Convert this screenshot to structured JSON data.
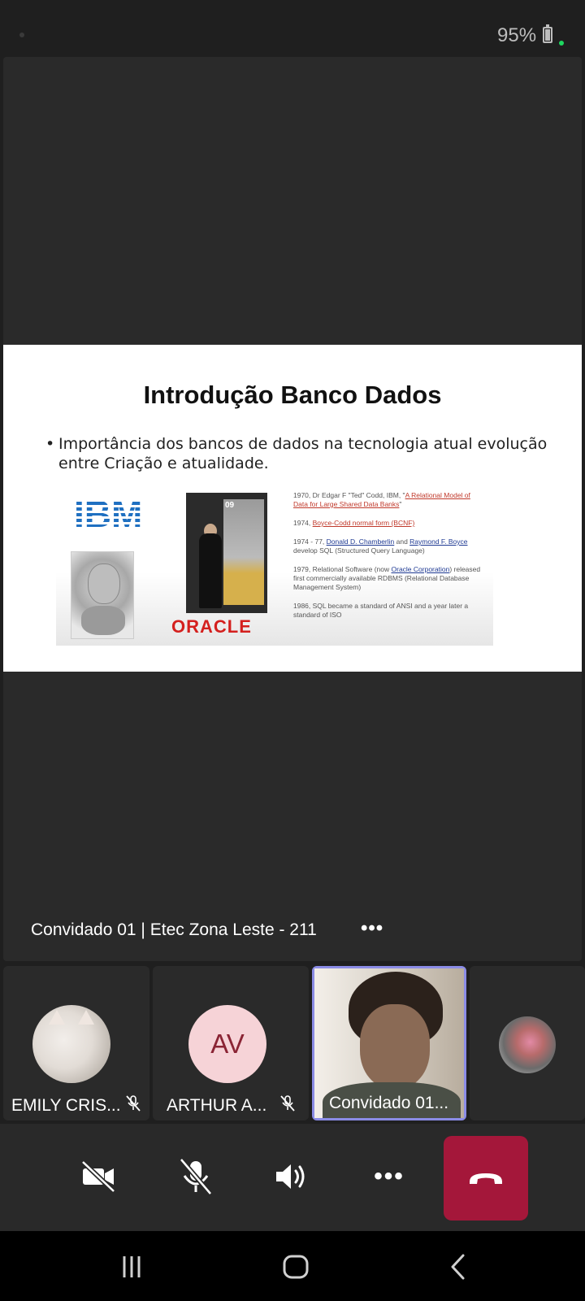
{
  "status_bar": {
    "battery_percent": "95%"
  },
  "slide": {
    "title": "Introdução Banco Dados",
    "bullet": "Importância dos bancos de dados na tecnologia atual evolução entre Criação e atualidade.",
    "bullet_marker": "•",
    "ibm_logo_text": "IBM",
    "oracle_logo_text": "ORACLE",
    "photo_number": "09",
    "timeline": {
      "item1_prefix": "1970, Dr Edgar F \"Ted\" Codd, IBM, \"",
      "item1_link": "A Relational Model of Data for Large Shared Data Banks",
      "item1_suffix": "\"",
      "item2_prefix": "1974, ",
      "item2_link": "Boyce-Codd normal form (BCNF)",
      "item3_prefix": "1974 - 77, ",
      "item3_link1": "Donald D. Chamberlin",
      "item3_mid": " and ",
      "item3_link2": "Raymond F. Boyce",
      "item3_suffix": " develop SQL (Structured Query Language)",
      "item4_prefix": "1979, Relational Software (now ",
      "item4_link": "Oracle Corporation",
      "item4_suffix": ") released first commercially available RDBMS (Relational Database Management System)",
      "item5": "1986, SQL became a standard of ANSI and a year later a standard of ISO"
    }
  },
  "presenter": {
    "label": "Convidado 01 | Etec Zona Leste - 211",
    "more_dots": "•••"
  },
  "participants": [
    {
      "name": "EMILY CRIS...",
      "muted": true,
      "avatar": "cat-photo"
    },
    {
      "name": "ARTHUR A...",
      "muted": true,
      "initials": "AV",
      "avatar_bg": "#f6d3d7",
      "avatar_fg": "#8a2434"
    },
    {
      "name": "Convidado 01...",
      "active_speaker": true,
      "highlight_color": "#8b8ce6"
    },
    {
      "name": "",
      "avatar": "small-photo"
    }
  ],
  "controls": {
    "camera": "camera-off-icon",
    "mic": "mic-off-icon",
    "speaker": "speaker-icon",
    "more": "•••",
    "hangup_color": "#a4173a"
  },
  "navbar": {
    "recents": "recents-icon",
    "home": "home-icon",
    "back": "back-icon"
  }
}
